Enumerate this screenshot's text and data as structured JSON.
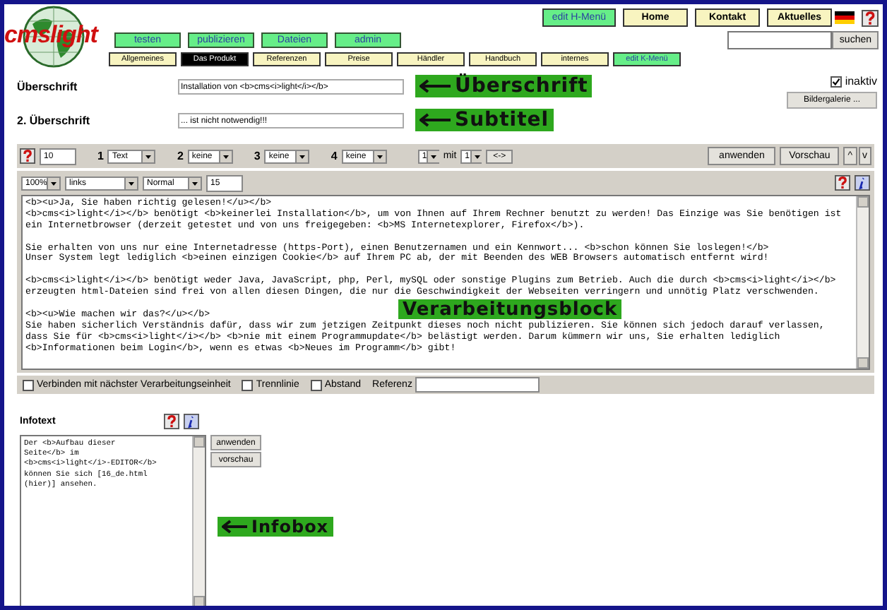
{
  "header": {
    "logo": "cmslight",
    "main_menu": [
      "testen",
      "publizieren",
      "Dateien",
      "admin"
    ],
    "top_menu": [
      {
        "label": "edit H-Menü",
        "kind": "edit"
      },
      {
        "label": "Home",
        "kind": "nav"
      },
      {
        "label": "Kontakt",
        "kind": "nav"
      },
      {
        "label": "Aktuelles",
        "kind": "nav"
      }
    ],
    "search_button": "suchen"
  },
  "tabs": [
    {
      "label": "Allgemeines",
      "selected": false,
      "kind": "nav"
    },
    {
      "label": "Das Produkt",
      "selected": true,
      "kind": "nav"
    },
    {
      "label": "Referenzen",
      "selected": false,
      "kind": "nav"
    },
    {
      "label": "Preise",
      "selected": false,
      "kind": "nav"
    },
    {
      "label": "Händler",
      "selected": false,
      "kind": "nav"
    },
    {
      "label": "Handbuch",
      "selected": false,
      "kind": "nav"
    },
    {
      "label": "internes",
      "selected": false,
      "kind": "nav"
    },
    {
      "label": "edit K-Menü",
      "selected": false,
      "kind": "edit"
    }
  ],
  "headings": [
    {
      "label": "Überschrift",
      "value": "Installation von <b>cms<i>light</i></b>",
      "callout": "Überschrift"
    },
    {
      "label": "2. Überschrift",
      "value": "... ist nicht notwendig!!!",
      "callout": "Subtitel"
    }
  ],
  "inactive": {
    "label": "inaktiv",
    "checked": true
  },
  "gallery_button": "Bildergalerie ...",
  "toolbar": {
    "number": "10",
    "columns": [
      {
        "index": "1",
        "value": "Text"
      },
      {
        "index": "2",
        "value": "keine"
      },
      {
        "index": "3",
        "value": "keine"
      },
      {
        "index": "4",
        "value": "keine"
      }
    ],
    "rows": "1",
    "joiner": "mit",
    "cols": "1",
    "swap": "<->",
    "apply": "anwenden",
    "preview": "Vorschau",
    "up": "^",
    "down": "v"
  },
  "block": {
    "zoom": "100%",
    "align": "links",
    "style": "Normal",
    "size": "15",
    "paragraphs": [
      [
        "<b><u>Ja, Sie haben richtig gelesen!</u></b>",
        "<b>cms<i>light</i></b> benötigt <b>keinerlei Installation</b>, um von Ihnen auf Ihrem Rechner benutzt zu werden! Das Einzige was Sie benötigen ist",
        "ein Internetbrowser (derzeit getestet und von uns freigegeben: <b>MS Internetexplorer, Firefox</b>)."
      ],
      [
        "Sie erhalten von uns nur eine Internetadresse (https-Port), einen Benutzernamen und ein Kennwort... <b>schon können Sie loslegen!</b>",
        "Unser System legt lediglich <b>einen einzigen Cookie</b> auf Ihrem PC ab, der mit Beenden des WEB Browsers automatisch entfernt wird!"
      ],
      [
        "<b>cms<i>light</i></b> benötigt weder Java, JavaScript, php, Perl, mySQL oder sonstige Plugins zum Betrieb. Auch die durch <b>cms<i>light</i></b>",
        "erzeugten html-Dateien sind frei von allen diesen Dingen, die nur die Geschwindigkeit der Webseiten verringern und unnötig Platz verschwenden."
      ],
      [
        "<b><u>Wie machen wir das?</u></b>",
        "Sie haben sicherlich Verständnis dafür, dass wir zum jetzigen Zeitpunkt dieses noch nicht publizieren. Sie können sich jedoch darauf verlassen,",
        "dass Sie für <b>cms<i>light</i></b> <b>nie mit einem Programmupdate</b> belästigt werden. Darum kümmern wir uns, Sie erhalten lediglich",
        "<b>Informationen beim Login</b>, wenn es etwas <b>Neues im Programm</b> gibt!"
      ]
    ],
    "callout": "Verarbeitungsblock"
  },
  "options": [
    {
      "label": "Verbinden mit nächster Verarbeitungseinheit",
      "checked": false
    },
    {
      "label": "Trennlinie",
      "checked": false
    },
    {
      "label": "Abstand",
      "checked": false
    }
  ],
  "reference_label": "Referenz",
  "info": {
    "title": "Infotext",
    "lines": [
      "Der <b>Aufbau dieser",
      "Seite</b> im",
      "<b>cms<i>light</i>-EDITOR</b>",
      "können Sie sich [16_de.html",
      "(hier)] ansehen."
    ],
    "apply": "anwenden",
    "preview": "vorschau",
    "callout": "Infobox"
  }
}
